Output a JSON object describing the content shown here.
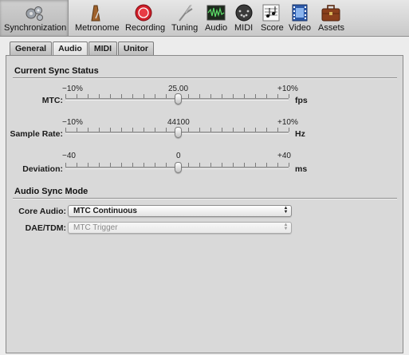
{
  "toolbar": {
    "items": [
      {
        "label": "Synchronization",
        "icon": "gears-icon"
      },
      {
        "label": "Metronome",
        "icon": "metronome-icon"
      },
      {
        "label": "Recording",
        "icon": "record-icon"
      },
      {
        "label": "Tuning",
        "icon": "tuning-fork-icon"
      },
      {
        "label": "Audio",
        "icon": "audio-waveform-icon"
      },
      {
        "label": "MIDI",
        "icon": "midi-connector-icon"
      },
      {
        "label": "Score",
        "icon": "score-notes-icon"
      },
      {
        "label": "Video",
        "icon": "film-strip-icon"
      },
      {
        "label": "Assets",
        "icon": "briefcase-icon"
      }
    ],
    "selected": "Synchronization"
  },
  "tabs": {
    "items": [
      "General",
      "Audio",
      "MIDI",
      "Unitor"
    ],
    "active": "Audio"
  },
  "sync_status": {
    "title": "Current Sync Status",
    "mtc": {
      "label": "MTC:",
      "min": "−10%",
      "center": "25.00",
      "max": "+10%",
      "unit": "fps",
      "value_fraction": 0.5
    },
    "sample_rate": {
      "label": "Sample Rate:",
      "min": "−10%",
      "center": "44100",
      "max": "+10%",
      "unit": "Hz",
      "value_fraction": 0.5
    },
    "deviation": {
      "label": "Deviation:",
      "min": "−40",
      "center": "0",
      "max": "+40",
      "unit": "ms",
      "value_fraction": 0.5
    }
  },
  "sync_mode": {
    "title": "Audio Sync Mode",
    "core_audio": {
      "label": "Core Audio:",
      "value": "MTC Continuous"
    },
    "dae_tdm": {
      "label": "DAE/TDM:",
      "value": "MTC Trigger",
      "enabled": false
    }
  }
}
